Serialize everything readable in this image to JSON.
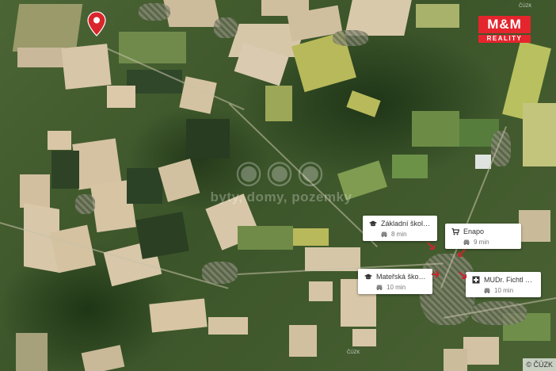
{
  "brand": {
    "mark": "M&M",
    "sub": "REALITY"
  },
  "watermark": {
    "text": "byty, domy, pozemky"
  },
  "pois": [
    {
      "title": "Základní škola, st...",
      "time": "8 min",
      "icon": "school-icon"
    },
    {
      "title": "Enapo",
      "time": "9 min",
      "icon": "shopping-cart-icon"
    },
    {
      "title": "Mateřská škola St...",
      "time": "10 min",
      "icon": "school-icon"
    },
    {
      "title": "MUDr. Fichtl Karel",
      "time": "10 min",
      "icon": "medical-cross-icon"
    }
  ],
  "transport_icon": "car-icon",
  "map_tags": {
    "top": "ČÚZK",
    "bottom": "ČÚZK"
  },
  "copyright": "© ČÚZK",
  "colors": {
    "pin": "#d9262c",
    "brand": "#e4252d"
  }
}
